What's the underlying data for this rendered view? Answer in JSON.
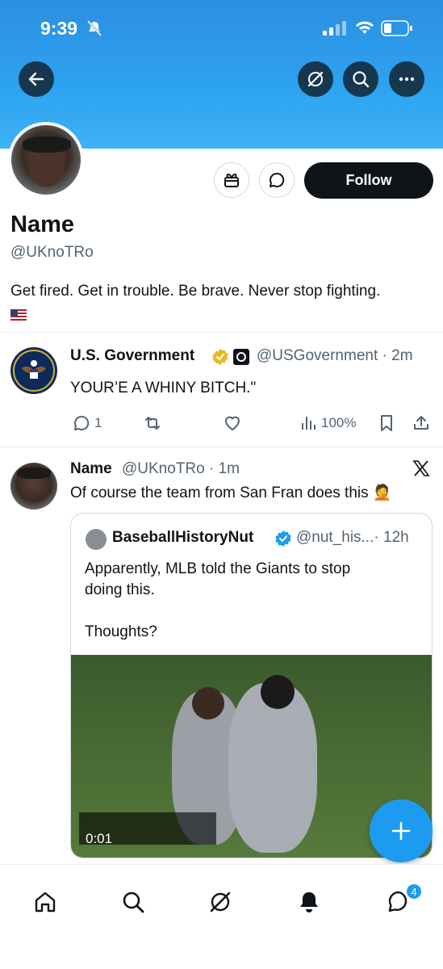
{
  "status_bar": {
    "time": "9:39"
  },
  "profile": {
    "name": "Name",
    "handle": "@UKnoTRo",
    "bio": "Get fired. Get in trouble. Be brave. Never stop fighting.",
    "follow_label": "Follow"
  },
  "tweet1": {
    "name": "U.S. Government",
    "handle": "@USGovernment",
    "time": "· 2m",
    "text": "YOUR’E A WHINY BITCH.\"",
    "replies": "1",
    "views": "100%"
  },
  "tweet2": {
    "name": "Name",
    "handle": "@UKnoTRo",
    "time": "· 1m",
    "text": "Of course the team from San Fran does this 🤦",
    "quote": {
      "name": "BaseballHistoryNut",
      "handle": "@nut_his...",
      "time": "· 12h",
      "text_line1": "Apparently, MLB told the Giants to stop",
      "text_line2": "doing this.",
      "text_line3": "Thoughts?",
      "video_time": "0:01"
    }
  },
  "tabbar": {
    "messages_badge": "4"
  },
  "colors": {
    "accent": "#1d9bf0",
    "banner": "#2ea3f0",
    "verified_gold": "#e8b923"
  }
}
